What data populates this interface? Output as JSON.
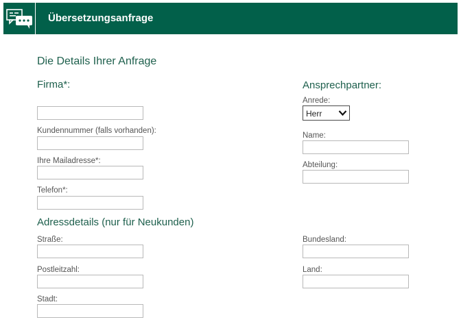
{
  "header": {
    "title": "Übersetzungsanfrage",
    "icon": "chat-bubbles-icon"
  },
  "form": {
    "section_title": "Die Details Ihrer Anfrage",
    "company": {
      "heading": "Firma*:",
      "value": ""
    },
    "customer_number": {
      "label": "Kundennummer (falls vorhanden):",
      "value": ""
    },
    "email": {
      "label": "Ihre Mailadresse*:",
      "value": ""
    },
    "phone": {
      "label": "Telefon*:",
      "value": ""
    },
    "contact": {
      "heading": "Ansprechpartner:",
      "salutation": {
        "label": "Anrede:",
        "selected": "Herr"
      },
      "name": {
        "label": "Name:",
        "value": ""
      },
      "department": {
        "label": "Abteilung:",
        "value": ""
      }
    },
    "address": {
      "heading": "Adressdetails (nur für Neukunden)",
      "street": {
        "label": "Straße:",
        "value": ""
      },
      "postal_code": {
        "label": "Postleitzahl:",
        "value": ""
      },
      "city": {
        "label": "Stadt:",
        "value": ""
      },
      "state": {
        "label": "Bundesland:",
        "value": ""
      },
      "country": {
        "label": "Land:",
        "value": ""
      }
    }
  },
  "colors": {
    "header_bg": "#02604a",
    "heading": "#1d5f4c",
    "label": "#555555"
  }
}
